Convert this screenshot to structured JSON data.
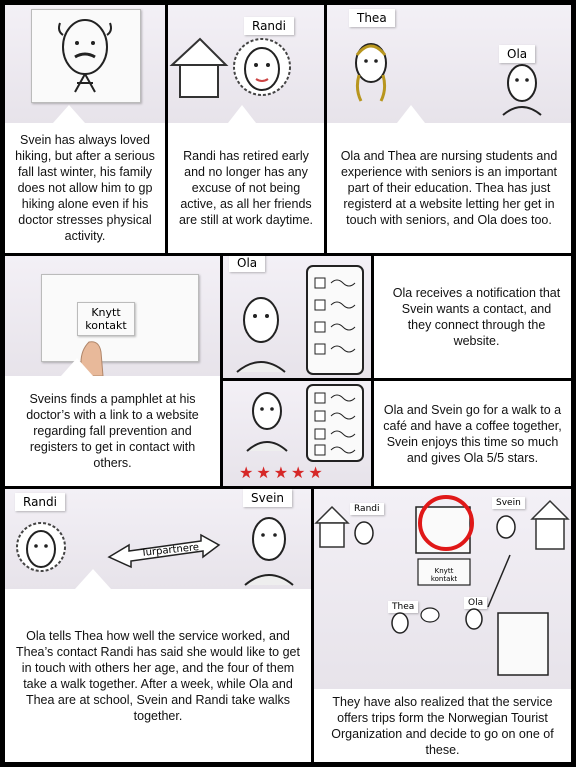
{
  "panels": {
    "p1": {
      "caption": "Svein has always loved hiking, but after a serious fall last winter, his family does not allow him to gp hiking alone even if his doctor stresses physical activity."
    },
    "p2": {
      "name_tag": "Randi",
      "caption": "Randi has retired early and no longer has any excuse of not being active, as all her friends are still at work daytime."
    },
    "p3": {
      "name_tag_a": "Thea",
      "name_tag_b": "Ola",
      "caption": "Ola and Thea are nursing students and experience with seniors is an important part of their education. Thea has just registerd at a website letting her get in touch with seniors, and Ola does too."
    },
    "p4": {
      "button_text_line1": "Knytt",
      "button_text_line2": "kontakt",
      "caption": "Sveins finds a pamphlet at his doctor’s with a link to a website regarding fall prevention and registers to get in contact with others."
    },
    "p5": {
      "name_tag": "Ola",
      "caption": "Ola receives a notification that Svein wants a contact, and they connect through the website."
    },
    "p6": {
      "caption": "Ola and Svein go for a walk to a café and have a coffee together, Svein enjoys this time so much and gives Ola 5/5 stars.",
      "rating": 5,
      "rating_max": 5
    },
    "p7": {
      "name_tag_a": "Randi",
      "name_tag_b": "Svein",
      "arrow_label": "Turpartnere",
      "caption": "Ola tells Thea how well the service worked, and Thea’s contact Randi has said she would like to get in touch with others her age, and the four of them take a walk together. After a week, while Ola and Thea are at school, Svein and Randi take walks together."
    },
    "p8": {
      "name_randi": "Randi",
      "name_svein": "Svein",
      "name_thea": "Thea",
      "name_ola": "Ola",
      "mini_button": "Knytt kontakt",
      "caption": "They have also realized that the service offers trips form the Norwegian Tourist Organization and decide to go on one of these."
    }
  },
  "colors": {
    "highlight": "#e01818",
    "star": "#d62828",
    "frame": "#000000"
  }
}
